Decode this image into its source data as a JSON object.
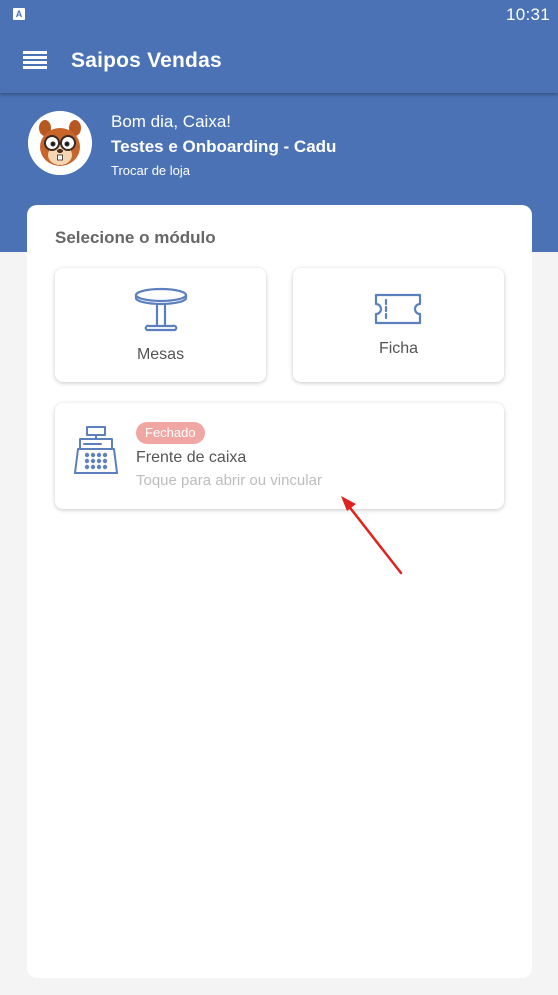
{
  "status_bar": {
    "indicator": "A",
    "time": "10:31"
  },
  "app_bar": {
    "title": "Saipos Vendas",
    "menu_icon": "menu-icon"
  },
  "header": {
    "greeting": "Bom dia, Caixa!",
    "store_name": "Testes e Onboarding - Cadu",
    "change_store_label": "Trocar de loja",
    "avatar_icon": "squirrel-mascot-avatar"
  },
  "modules": {
    "section_title": "Selecione o módulo",
    "mesas": {
      "label": "Mesas",
      "icon": "table-icon"
    },
    "ficha": {
      "label": "Ficha",
      "icon": "ticket-icon"
    },
    "frente_caixa": {
      "badge": "Fechado",
      "title": "Frente de caixa",
      "hint": "Toque para abrir ou vincular",
      "icon": "cash-register-icon"
    }
  },
  "colors": {
    "primary": "#4a72b5",
    "badge": "#f0a7a3",
    "icon": "#5b80bd",
    "annotation_arrow": "#e0231f"
  }
}
